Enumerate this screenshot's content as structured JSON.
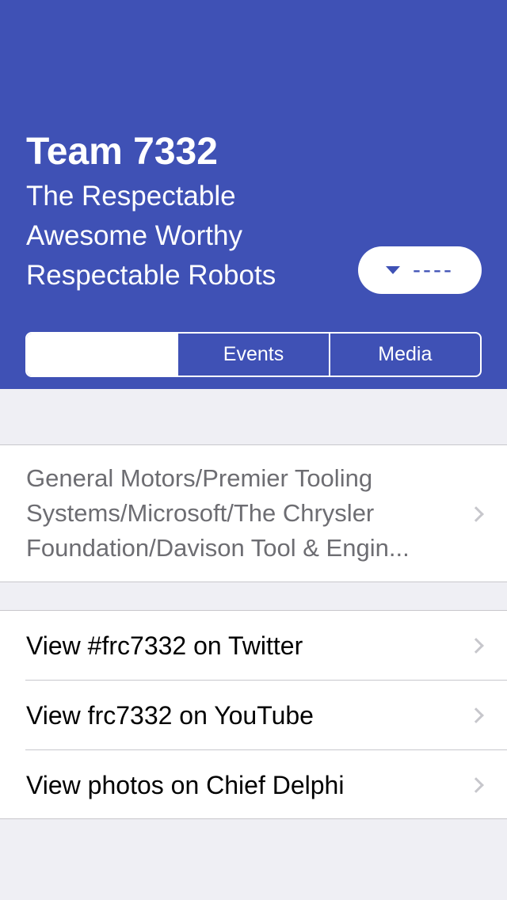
{
  "header": {
    "team_title": "Team 7332",
    "nickname": "The Respectable Awesome Worthy Respectable Robots",
    "year_button": {
      "label": "----",
      "icon": "caret-down-icon"
    },
    "tabs": [
      {
        "label": "",
        "selected": true
      },
      {
        "label": "Events",
        "selected": false
      },
      {
        "label": "Media",
        "selected": false
      }
    ]
  },
  "info": {
    "sponsors": "General Motors/Premier Tooling Systems/Microsoft/The Chrysler Foundation/Davison Tool & Engin..."
  },
  "links": [
    {
      "label": "View #frc7332 on Twitter"
    },
    {
      "label": "View frc7332 on YouTube"
    },
    {
      "label": "View photos on Chief Delphi"
    }
  ],
  "colors": {
    "primary": "#3f51b5",
    "background": "#efeff4",
    "secondary_text": "#6d6d72",
    "chevron": "#c7c7cc"
  }
}
